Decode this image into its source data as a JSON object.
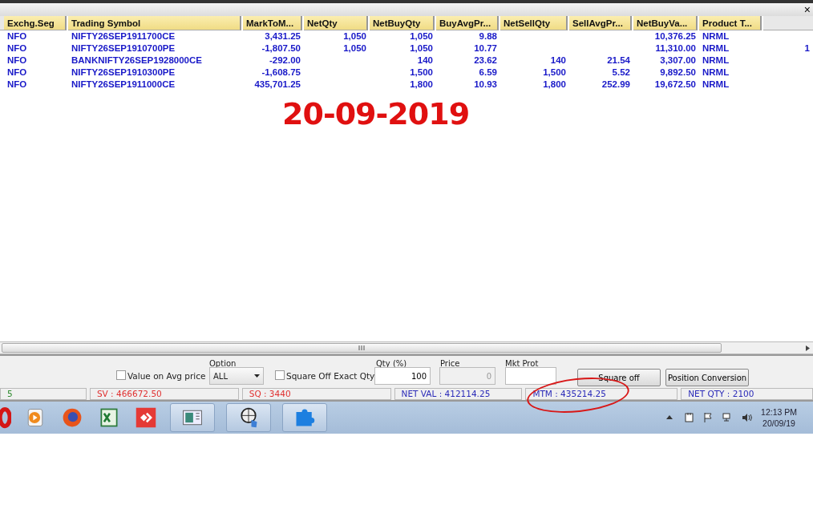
{
  "window": {
    "close": "×"
  },
  "table": {
    "columns": [
      "Exchg.Seg",
      "Trading Symbol",
      "MarkToM...",
      "NetQty",
      "NetBuyQty",
      "BuyAvgPr...",
      "NetSellQty",
      "SellAvgPr...",
      "NetBuyVa...",
      "Product T..."
    ],
    "rows": [
      {
        "cells": [
          "NFO",
          "NIFTY26SEP1911700CE",
          "3,431.25",
          "1,050",
          "1,050",
          "9.88",
          "",
          "",
          "10,376.25",
          "NRML"
        ],
        "overflow": ""
      },
      {
        "cells": [
          "NFO",
          "NIFTY26SEP1910700PE",
          "-1,807.50",
          "1,050",
          "1,050",
          "10.77",
          "",
          "",
          "11,310.00",
          "NRML"
        ],
        "overflow": "1"
      },
      {
        "cells": [
          "NFO",
          "BANKNIFTY26SEP1928000CE",
          "-292.00",
          "",
          "140",
          "23.62",
          "140",
          "21.54",
          "3,307.00",
          "NRML"
        ],
        "overflow": ""
      },
      {
        "cells": [
          "NFO",
          "NIFTY26SEP1910300PE",
          "-1,608.75",
          "",
          "1,500",
          "6.59",
          "1,500",
          "5.52",
          "9,892.50",
          "NRML"
        ],
        "overflow": ""
      },
      {
        "cells": [
          "NFO",
          "NIFTY26SEP1911000CE",
          "435,701.25",
          "",
          "1,800",
          "10.93",
          "1,800",
          "252.99",
          "19,672.50",
          "NRML"
        ],
        "overflow": ""
      }
    ]
  },
  "annotation": {
    "date": "20-09-2019"
  },
  "controls": {
    "value_on_avg": {
      "label": "Value on Avg  price",
      "checked": false
    },
    "option": {
      "label": "Option",
      "value": "ALL"
    },
    "square_off_exact": {
      "label": "Square Off Exact Qty",
      "checked": false
    },
    "qty": {
      "label": "Qty (%)",
      "value": "100"
    },
    "price": {
      "label": "Price",
      "value": "0",
      "disabled": true
    },
    "mkt_prot": {
      "label": "Mkt Prot"
    },
    "buttons": [
      "Square off",
      "Position Conversion"
    ]
  },
  "status_bar": [
    {
      "text": "5",
      "color": "#2e8b2e",
      "circled": false
    },
    {
      "text": "SV : 466672.50",
      "color": "#e03030",
      "circled": false
    },
    {
      "text": "SQ : 3440",
      "color": "#e03030",
      "circled": false
    },
    {
      "text": "NET VAL : 412114.25",
      "color": "#2a2ab8",
      "circled": false
    },
    {
      "text": "MTM : 435214.25",
      "color": "#2a2ab8",
      "circled": true
    },
    {
      "text": "NET QTY : 2100",
      "color": "#2a2ab8",
      "circled": false
    }
  ],
  "taskbar": {
    "time": "12:13 PM",
    "date": "20/09/19"
  }
}
